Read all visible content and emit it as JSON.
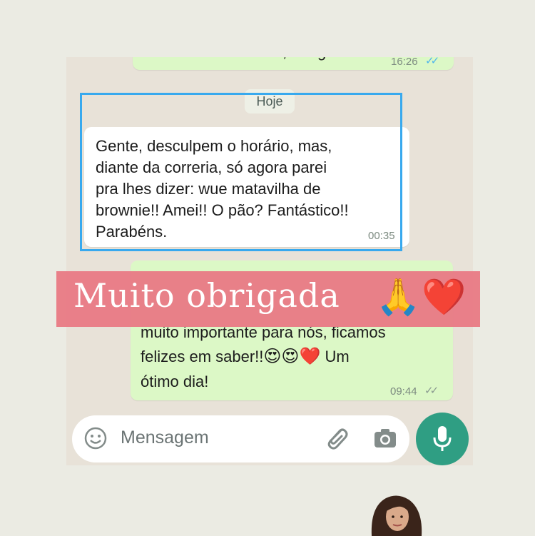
{
  "chat": {
    "prev_message": {
      "text": "Recebido Terezinha, obrigada",
      "time": "16:26"
    },
    "day_label": "Hoje",
    "incoming_message": {
      "text": "Gente, desculpem o horário, mas,\ndiante da correria, só agora parei\npra lhes dizer: wue matavilha de\nbrownie!! Amei!! O pão? Fantástico!!\nParabéns.",
      "time": "00:35"
    },
    "reply_message": {
      "line1": "muito importante para nós, ficamos",
      "line2": "felizes em saber!!",
      "line2_after": " Um",
      "line3": "ótimo dia!",
      "emojis": "😍😍❤️",
      "time": "09:44"
    }
  },
  "overlay": {
    "caption": "Muito obrigada",
    "emoji1": "🙏",
    "emoji2": "❤️"
  },
  "input": {
    "placeholder": "Mensagem"
  },
  "colors": {
    "accent": "#2f9e83",
    "outgoing_bubble": "#dcf8c6",
    "highlight_border": "#38a9ee",
    "banner": "#e87c86",
    "read_ticks": "#4fb6ec"
  },
  "icons": [
    "emoji-icon",
    "attach-icon",
    "camera-icon",
    "mic-icon",
    "double-check-icon"
  ]
}
